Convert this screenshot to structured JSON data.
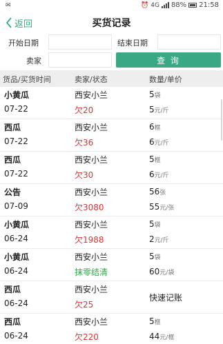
{
  "status_bar": {
    "left_icon": "notification-icon",
    "network": "4G",
    "battery": "88%",
    "time": "21:58"
  },
  "header": {
    "back_label": "返回",
    "title": "买货记录"
  },
  "filters": {
    "start_date_label": "开始日期",
    "start_date_value": "",
    "end_date_label": "结束日期",
    "end_date_value": "",
    "seller_label": "卖家",
    "seller_value": "",
    "query_button": "查 询"
  },
  "table": {
    "columns": [
      "货品/买货时间",
      "卖家/状态",
      "数量/单价"
    ],
    "rows": [
      {
        "name": "小黄瓜",
        "date": "07-22",
        "seller": "西安小兰",
        "status": "欠20",
        "status_color": "red",
        "qty": "5",
        "qty_unit": "袋",
        "price": "5",
        "price_unit": "元/斤"
      },
      {
        "name": "西瓜",
        "date": "07-22",
        "seller": "西安小兰",
        "status": "欠36",
        "status_color": "red",
        "qty": "6",
        "qty_unit": "框",
        "price": "6",
        "price_unit": "元/斤"
      },
      {
        "name": "西瓜",
        "date": "07-22",
        "seller": "西安小兰",
        "status": "欠30",
        "status_color": "red",
        "qty": "5",
        "qty_unit": "框",
        "price": "6",
        "price_unit": "元/斤"
      },
      {
        "name": "公告",
        "date": "07-09",
        "seller": "西安小兰",
        "status": "欠3080",
        "status_color": "red",
        "qty": "56",
        "qty_unit": "张",
        "price": "55",
        "price_unit": "元/张"
      },
      {
        "name": "小黄瓜",
        "date": "06-24",
        "seller": "西安小兰",
        "status": "欠1988",
        "status_color": "red",
        "qty": "5",
        "qty_unit": "袋",
        "price": "2",
        "price_unit": "元/斤"
      },
      {
        "name": "小黄瓜",
        "date": "06-24",
        "seller": "西安小兰",
        "status": "抹零结清",
        "status_color": "green",
        "qty": "5",
        "qty_unit": "袋",
        "price": "60",
        "price_unit": "元/袋"
      },
      {
        "name": "西瓜",
        "date": "06-24",
        "seller": "西安小兰",
        "status": "欠25",
        "status_color": "red",
        "quick": "快速记账"
      },
      {
        "name": "西瓜",
        "date": "06-24",
        "seller": "西安小兰",
        "status": "欠220",
        "status_color": "red",
        "qty": "5",
        "qty_unit": "框",
        "price": "44",
        "price_unit": "元/框"
      }
    ]
  },
  "colors": {
    "accent": "#3aa885",
    "debt": "#dd3333",
    "settled": "#2ea84a"
  }
}
